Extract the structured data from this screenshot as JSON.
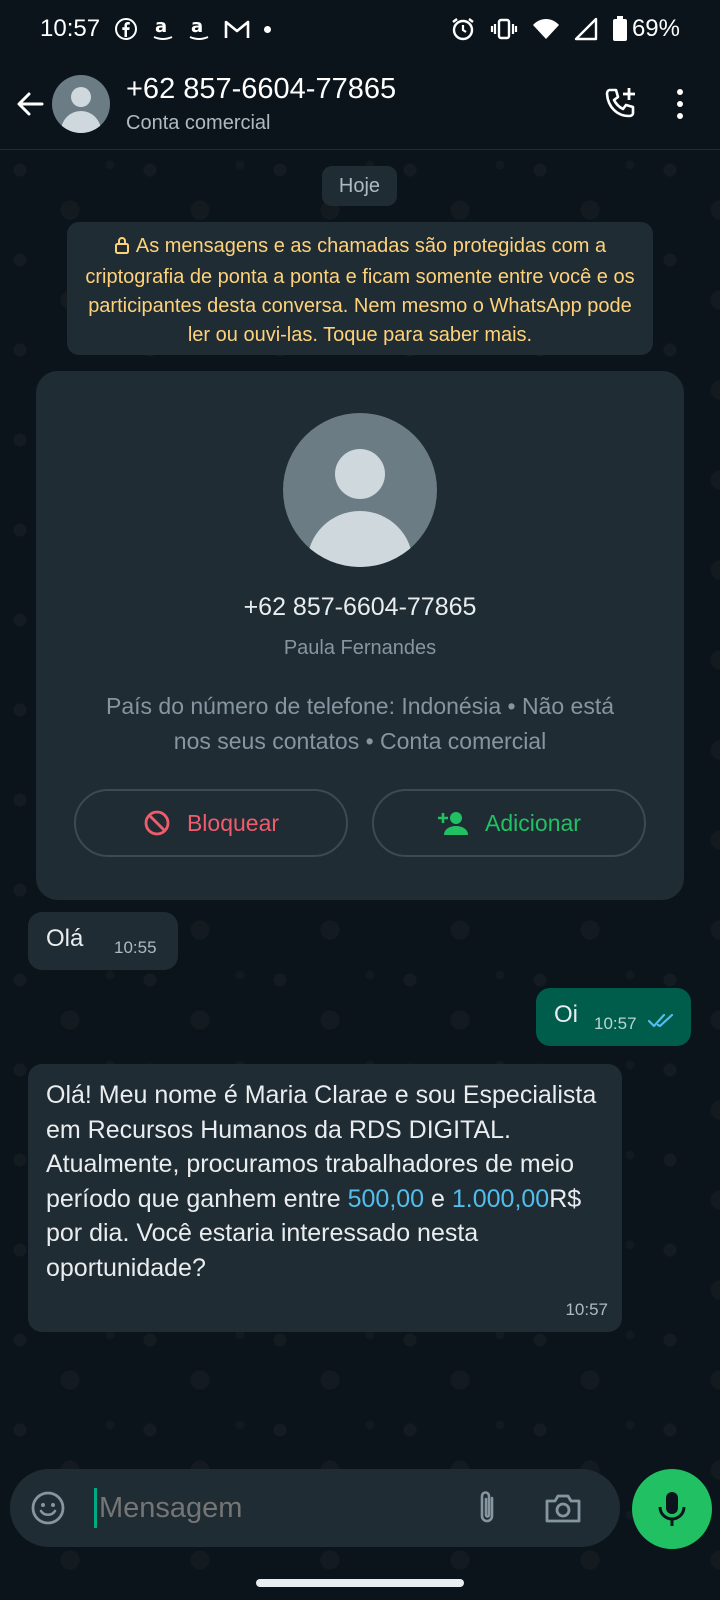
{
  "status_bar": {
    "time": "10:57",
    "notifications": [
      "facebook-icon",
      "amazon-icon",
      "amazon-icon",
      "gmail-icon"
    ],
    "battery": "69%"
  },
  "header": {
    "title": "+62 857-6604-77865",
    "subtitle": "Conta comercial"
  },
  "date_chip": "Hoje",
  "encryption_notice": "As mensagens e as chamadas são protegidas com a criptografia de ponta a ponta e ficam somente entre você e os participantes desta conversa. Nem mesmo o WhatsApp pode ler ou ouvi-las. Toque para saber mais.",
  "contact_card": {
    "phone": "+62 857-6604-77865",
    "name": "Paula Fernandes",
    "info": "País do número de telefone: Indonésia • Não está nos seus contatos • Conta comercial",
    "block_label": "Bloquear",
    "add_label": "Adicionar"
  },
  "messages": [
    {
      "direction": "in",
      "text": "Olá",
      "time": "10:55"
    },
    {
      "direction": "out",
      "text": "Oi",
      "time": "10:57",
      "status": "read"
    },
    {
      "direction": "in",
      "text_before": "Olá! Meu nome é Maria Clarae e sou Especialista em Recursos Humanos da RDS DIGITAL. Atualmente, procuramos trabalhadores de meio período que ganhem entre ",
      "link1": "500,00",
      "text_mid": " e ",
      "link2": "1.000,00",
      "text_after": "R$ por dia. Você estaria interessado nesta oportunidade?",
      "time": "10:57"
    }
  ],
  "input": {
    "placeholder": "Mensagem"
  },
  "colors": {
    "background": "#0b141a",
    "bubble_in": "#202c33",
    "bubble_out": "#005c4b",
    "accent_green": "#21c063",
    "danger": "#f15c6d",
    "notice_text": "#ffd279",
    "link": "#53bdeb"
  }
}
